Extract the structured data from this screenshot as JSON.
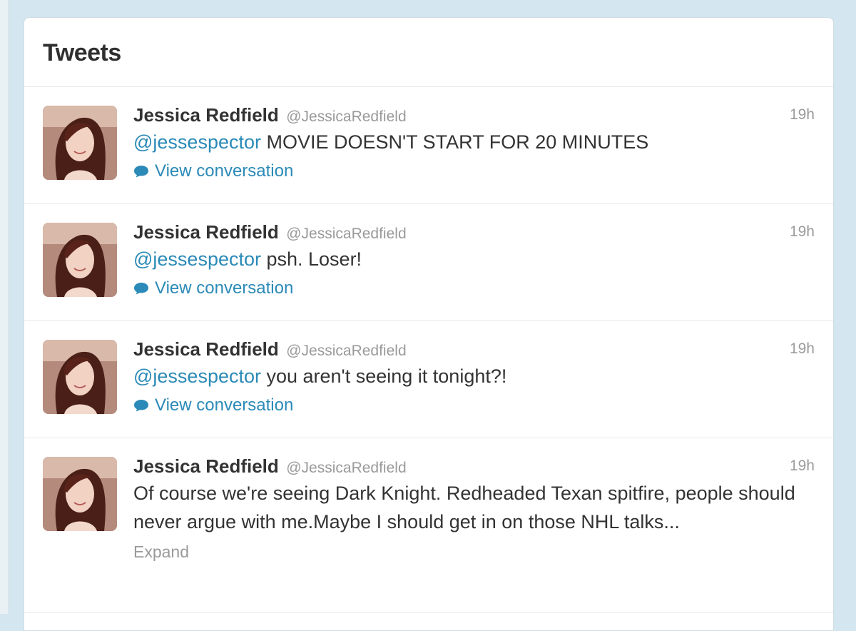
{
  "panel": {
    "title": "Tweets"
  },
  "tweets": [
    {
      "name": "Jessica Redfield",
      "username": "@JessicaRedfield",
      "time": "19h",
      "mention": "@jessespector",
      "text": " MOVIE DOESN'T START FOR 20 MINUTES",
      "link_label": "View conversation"
    },
    {
      "name": "Jessica Redfield",
      "username": "@JessicaRedfield",
      "time": "19h",
      "mention": "@jessespector",
      "text": " psh. Loser!",
      "link_label": "View conversation"
    },
    {
      "name": "Jessica Redfield",
      "username": "@JessicaRedfield",
      "time": "19h",
      "mention": "@jessespector",
      "text": " you aren't seeing it tonight?!",
      "link_label": "View conversation"
    },
    {
      "name": "Jessica Redfield",
      "username": "@JessicaRedfield",
      "time": "19h",
      "text": "Of course we're seeing Dark Knight. Redheaded Texan spitfire, people should never argue with me.Maybe I should get in on those NHL talks...",
      "link_label": "Expand"
    }
  ],
  "colors": {
    "link": "#2b8ab7",
    "name": "#333333",
    "muted": "#9a9a9a",
    "background": "#d4e6ef"
  },
  "icons": {
    "avatar": "profile-photo",
    "conversation": "speech-bubble-icon"
  }
}
